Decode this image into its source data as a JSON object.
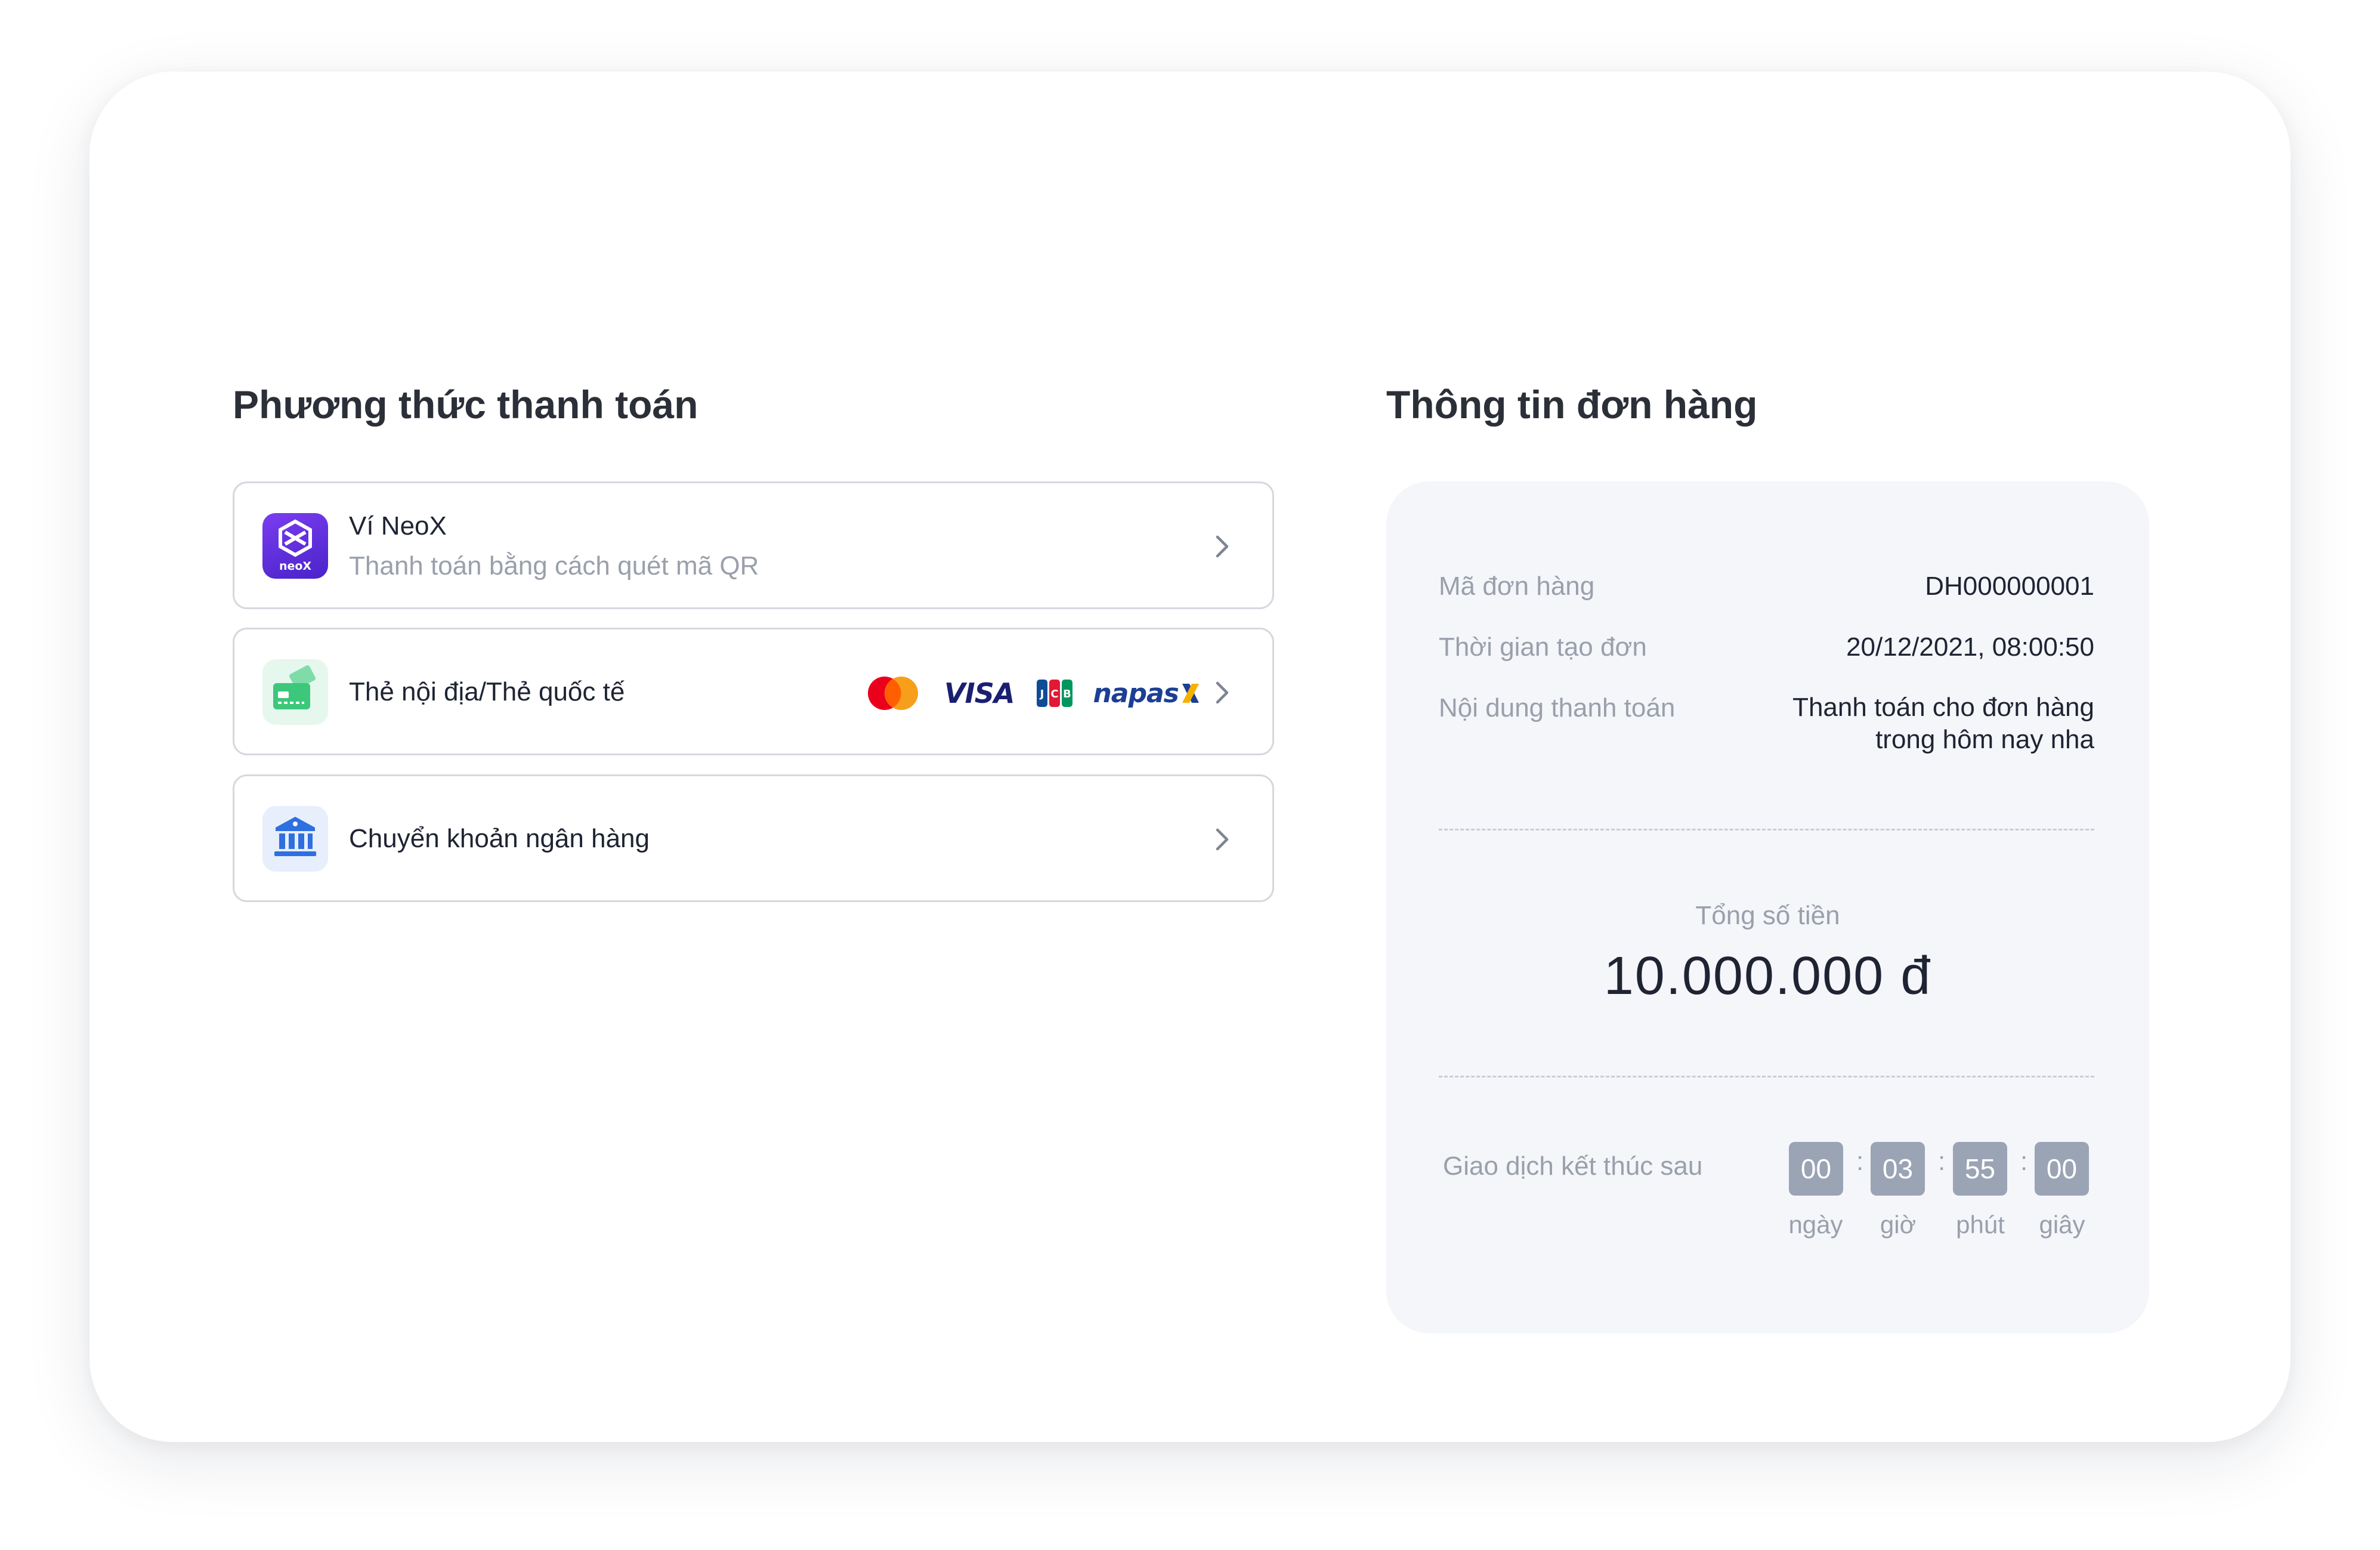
{
  "payment": {
    "title": "Phương thức thanh toán",
    "methods": [
      {
        "name": "Ví NeoX",
        "subtitle": "Thanh toán bằng cách quét mã QR",
        "icon": "neox-wallet-icon",
        "logo_text": "neoX"
      },
      {
        "name": "Thẻ nội địa/Thẻ quốc tế",
        "icon": "credit-card-icon",
        "brands": {
          "mastercard": "mastercard-logo",
          "visa": "VISA",
          "jcb": "JCB",
          "napas": "napas"
        }
      },
      {
        "name": "Chuyển khoản ngân hàng",
        "icon": "bank-icon"
      }
    ]
  },
  "order": {
    "title": "Thông tin đơn hàng",
    "fields": [
      {
        "label": "Mã đơn hàng",
        "value": "DH000000001"
      },
      {
        "label": "Thời gian tạo đơn",
        "value": "20/12/2021, 08:00:50"
      },
      {
        "label": "Nội dung thanh toán",
        "value": "Thanh toán cho đơn hàng\ntrong hôm nay nha"
      }
    ],
    "total": {
      "label": "Tổng số tiền",
      "amount": "10.000.000 đ"
    },
    "countdown": {
      "label": "Giao dịch kết thúc sau",
      "days": "00",
      "hours": "03",
      "minutes": "55",
      "seconds": "00",
      "unit_days": "ngày",
      "unit_hours": "giờ",
      "unit_minutes": "phút",
      "unit_seconds": "giây",
      "separator": ":"
    }
  },
  "colors": {
    "card_border": "#d5d8de",
    "panel_bg": "#f4f6fa",
    "countdown_bg": "#9ba4b5",
    "neox_purple": "#6b32e6",
    "card_green": "#3cc77a",
    "bank_blue": "#2f6fe0",
    "muted_text": "#9aa0ab"
  }
}
